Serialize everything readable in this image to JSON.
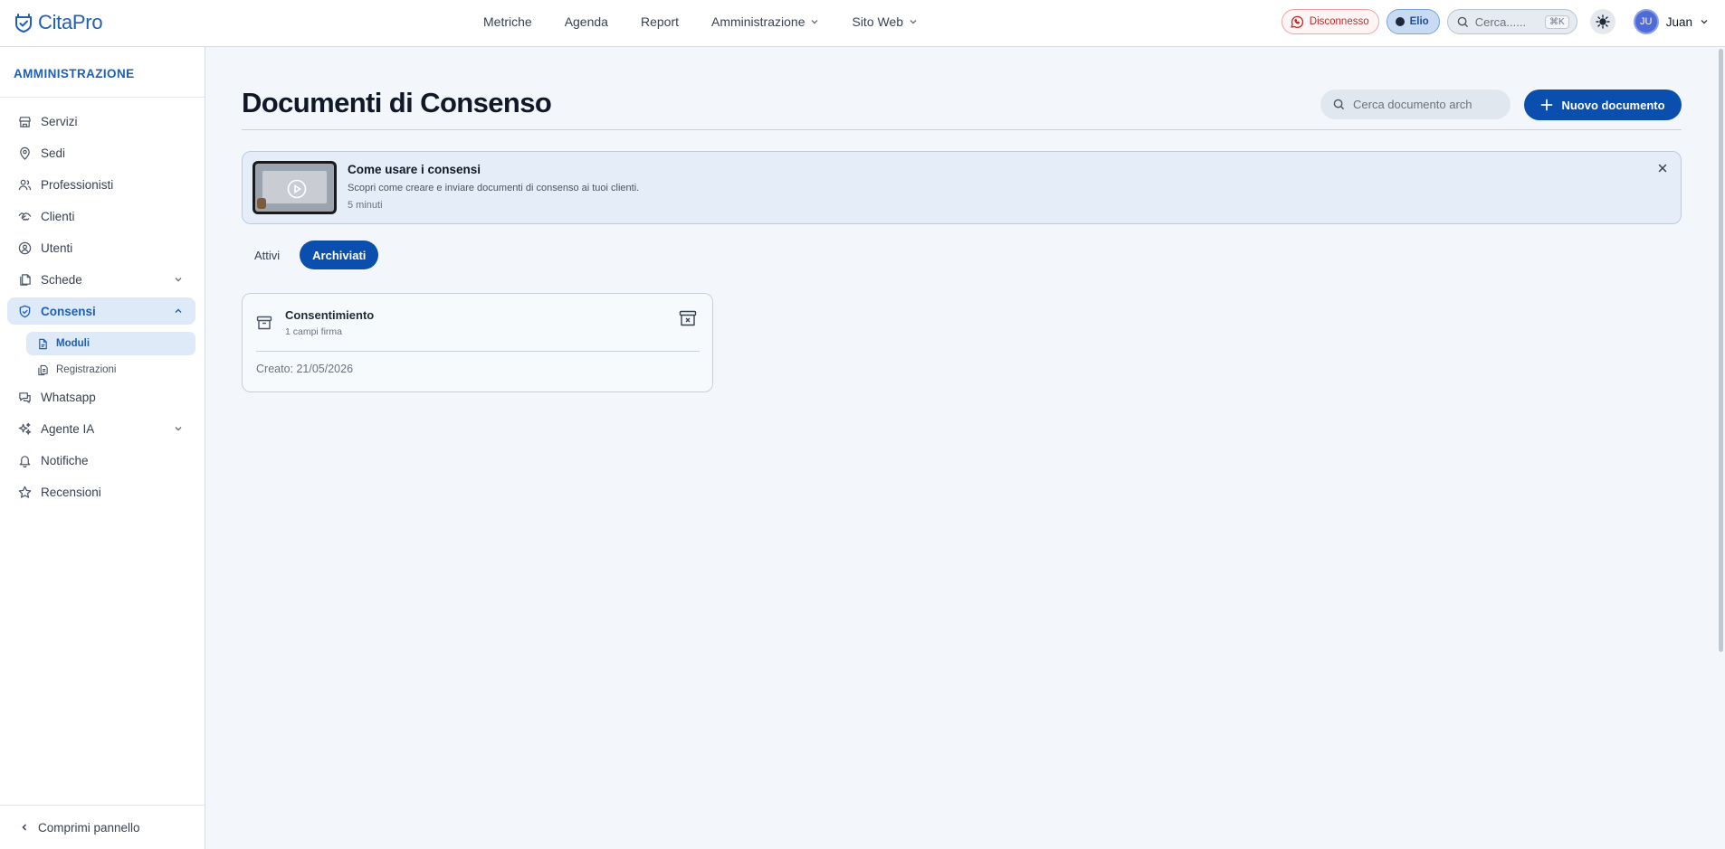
{
  "app": {
    "brand": "CitaPro"
  },
  "topnav": {
    "items": [
      {
        "label": "Metriche",
        "has_menu": false
      },
      {
        "label": "Agenda",
        "has_menu": false
      },
      {
        "label": "Report",
        "has_menu": false
      },
      {
        "label": "Amministrazione",
        "has_menu": true
      },
      {
        "label": "Sito Web",
        "has_menu": true
      }
    ]
  },
  "topbar": {
    "connection_status": "Disconnesso",
    "connection_color": "#c62828",
    "assistant_name": "Elio",
    "search_placeholder": "Cerca......",
    "search_shortcut": "⌘K",
    "user_initials": "JU",
    "user_name": "Juan"
  },
  "sidebar": {
    "section_title": "AMMINISTRAZIONE",
    "items": [
      {
        "label": "Servizi",
        "icon": "store-icon"
      },
      {
        "label": "Sedi",
        "icon": "map-pin-icon"
      },
      {
        "label": "Professionisti",
        "icon": "users-icon"
      },
      {
        "label": "Clienti",
        "icon": "handshake-icon"
      },
      {
        "label": "Utenti",
        "icon": "user-circle-icon"
      },
      {
        "label": "Schede",
        "icon": "files-icon",
        "expandable": true
      },
      {
        "label": "Consensi",
        "icon": "shield-check-icon",
        "expandable": true,
        "active": true
      },
      {
        "label": "Whatsapp",
        "icon": "chat-icon"
      },
      {
        "label": "Agente IA",
        "icon": "sparkles-icon",
        "expandable": true
      },
      {
        "label": "Notifiche",
        "icon": "bell-icon"
      },
      {
        "label": "Recensioni",
        "icon": "star-icon"
      }
    ],
    "sub_items": [
      {
        "label": "Moduli",
        "icon": "file-icon",
        "active": true
      },
      {
        "label": "Registrazioni",
        "icon": "copy-icon"
      }
    ],
    "collapse_label": "Comprimi pannello"
  },
  "page": {
    "title": "Documenti di Consenso",
    "search_placeholder": "Cerca documento arch",
    "new_button_label": "Nuovo documento",
    "accent_color": "#0b4fae"
  },
  "banner": {
    "title": "Come usare i consensi",
    "description": "Scopri come creare e inviare documenti di consenso ai tuoi clienti.",
    "duration": "5 minuti"
  },
  "tabs": [
    {
      "label": "Attivi",
      "active": false
    },
    {
      "label": "Archiviati",
      "active": true
    }
  ],
  "documents": [
    {
      "title": "Consentimiento",
      "subtitle": "1 campi firma",
      "created": "Creato: 21/05/2026"
    }
  ]
}
